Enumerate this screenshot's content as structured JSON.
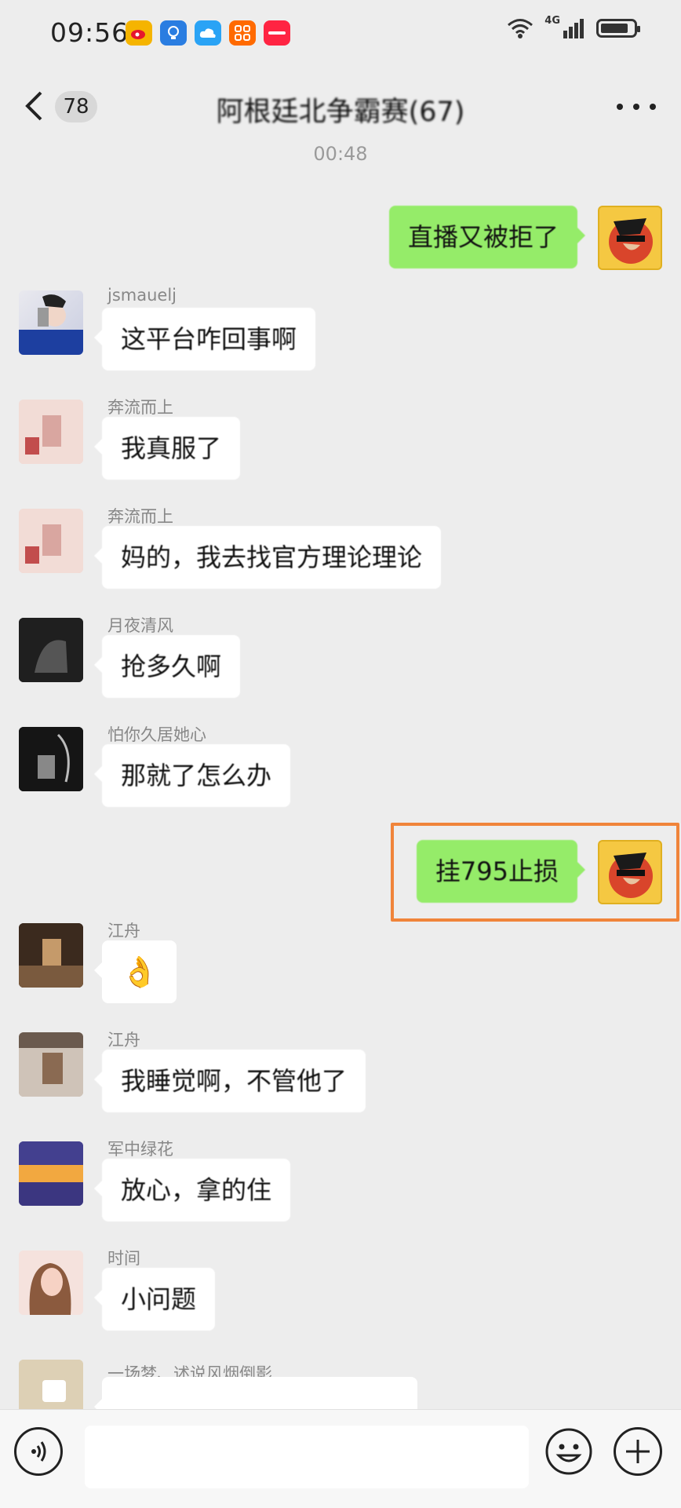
{
  "status_bar": {
    "time": "09:56",
    "network": "4G",
    "battery_level": 0.85
  },
  "header": {
    "unread_count": "78",
    "group_title": "阿根廷北争霸赛(67)"
  },
  "timestamp": "00:48",
  "messages": [
    {
      "side": "right",
      "text": "直播又被拒了"
    },
    {
      "side": "left",
      "sender": "jsmauelj",
      "text": "这平台咋回事啊"
    },
    {
      "side": "left",
      "sender": "奔流而上",
      "text": "我真服了"
    },
    {
      "side": "left",
      "sender": "奔流而上",
      "text": "妈的，我去找官方理论理论"
    },
    {
      "side": "left",
      "sender": "月夜清风",
      "text": "抢多久啊"
    },
    {
      "side": "left",
      "sender": "怕你久居她心",
      "text": "那就了怎么办"
    },
    {
      "side": "right",
      "text": "挂795止损",
      "highlighted": true
    },
    {
      "side": "left",
      "sender": "江舟",
      "text": "👌"
    },
    {
      "side": "left",
      "sender": "江舟",
      "text": "我睡觉啊，不管他了"
    },
    {
      "side": "left",
      "sender": "军中绿花",
      "text": "放心，拿的住"
    },
    {
      "side": "left",
      "sender": "时间",
      "text": "小问题"
    },
    {
      "side": "left",
      "sender": "一场梦、述说风烟倒影",
      "text": ""
    }
  ],
  "input": {
    "placeholder": ""
  },
  "colors": {
    "background": "#ededed",
    "self_bubble": "#95ec69",
    "other_bubble": "#ffffff",
    "highlight_box": "#f0843a"
  }
}
